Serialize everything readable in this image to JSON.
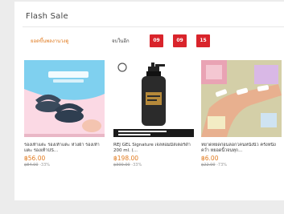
{
  "flash_sale": {
    "title": "Flash Sale",
    "sale_label": "ยอดขึ้นพลงานวงดู",
    "ends_label": "จบในอีก",
    "timer": [
      "09",
      "09",
      "15"
    ]
  },
  "products": [
    {
      "name": "รองเท้าแตะ รองเท้าแตะ ห่วงผ้า รองเท้าแตะ รองเท้าUS...",
      "price": "฿56.00",
      "original": "฿84.00",
      "discount": "-33%",
      "icon": "slippers-product-image"
    },
    {
      "name": "REJ GEL Signature เจลหอมมิสเตอร์ดำ 200 ml. (...",
      "price": "฿198.00",
      "original": "฿300.00",
      "discount": "-33%",
      "icon": "gel-bottle-product-image"
    },
    {
      "name": "หยาดหยดก่อนลอกโคนหนังนิ้ว ครั้งหนึ่งคว่ำ หยอดนิ้วจนทุก...",
      "price": "฿6.00",
      "original": "฿22.00",
      "discount": "-73%",
      "icon": "finger-band-product-image"
    }
  ]
}
